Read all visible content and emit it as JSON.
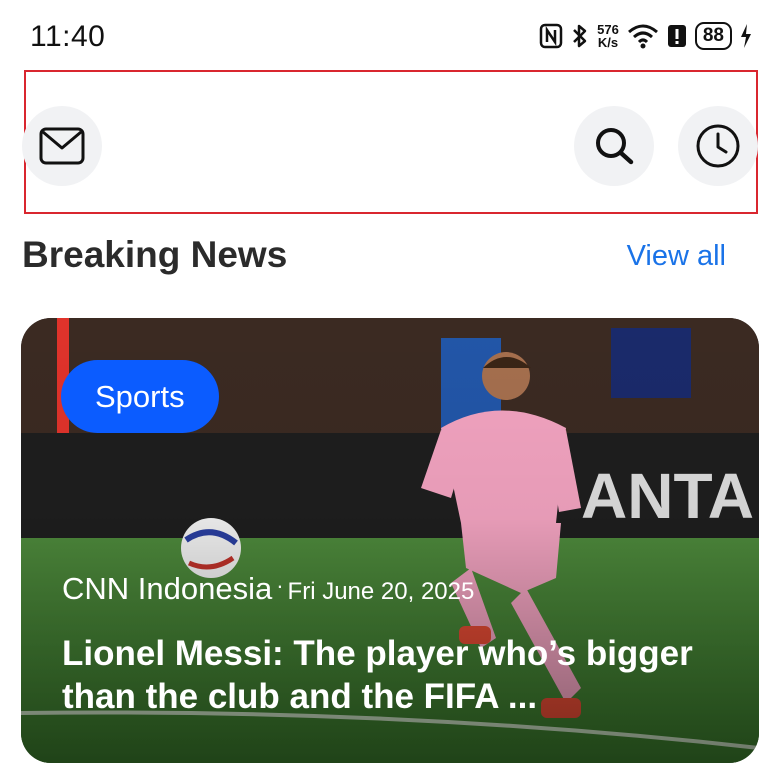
{
  "status_bar": {
    "time": "11:40",
    "network_speed_value": "576",
    "network_speed_unit": "K/s",
    "battery": "88",
    "icons": [
      "nfc-icon",
      "bluetooth-icon",
      "wifi-icon",
      "alert-icon",
      "battery-icon",
      "charging-icon"
    ]
  },
  "top_bar": {
    "icons": [
      "mail-icon",
      "search-icon",
      "history-icon"
    ]
  },
  "section": {
    "title": "Breaking News",
    "view_all": "View all"
  },
  "card": {
    "category": "Sports",
    "source": "CNN Indonesia",
    "separator": "·",
    "date": "Fri June 20, 2025",
    "headline": "Lionel Messi: The player who’s bigger than the club and the FIFA ..."
  },
  "colors": {
    "accent": "#1a73e8",
    "badge": "#0b5cff",
    "highlight_border": "#d9262f"
  }
}
